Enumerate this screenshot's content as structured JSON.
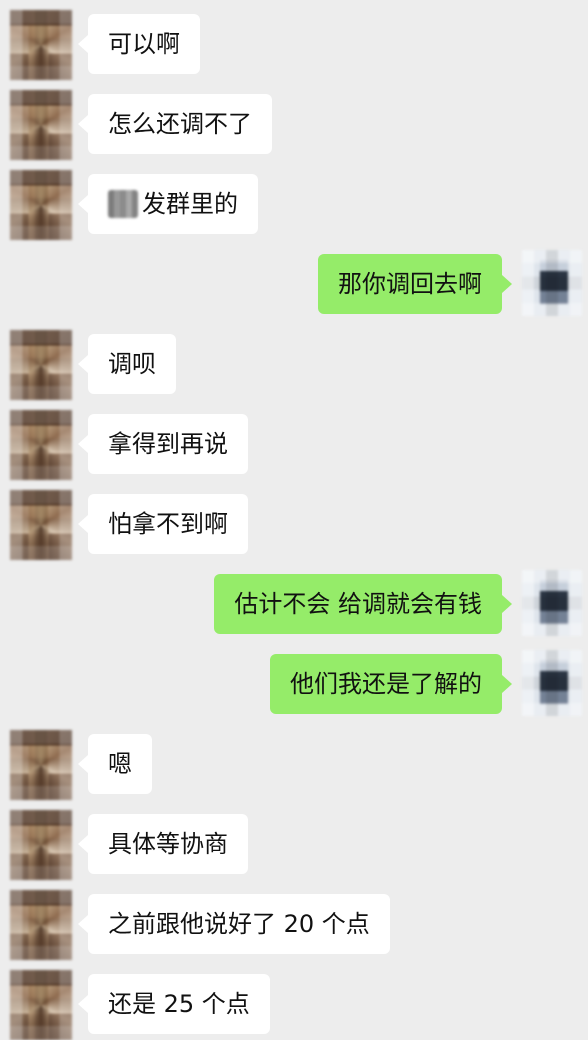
{
  "chat": {
    "messages": [
      {
        "side": "left",
        "text": "可以啊"
      },
      {
        "side": "left",
        "text": "怎么还调不了"
      },
      {
        "side": "left",
        "text": "发群里的",
        "redacted_prefix": true
      },
      {
        "side": "right",
        "text": "那你调回去啊"
      },
      {
        "side": "left",
        "text": "调呗"
      },
      {
        "side": "left",
        "text": "拿得到再说"
      },
      {
        "side": "left",
        "text": "怕拿不到啊"
      },
      {
        "side": "right",
        "text": "估计不会 给调就会有钱"
      },
      {
        "side": "right",
        "text": "他们我还是了解的"
      },
      {
        "side": "left",
        "text": "嗯"
      },
      {
        "side": "left",
        "text": "具体等协商"
      },
      {
        "side": "left",
        "text": "之前跟他说好了 20 个点"
      },
      {
        "side": "left",
        "text": "还是 25 个点"
      }
    ]
  },
  "colors": {
    "background": "#ededed",
    "incoming_bubble": "#ffffff",
    "outgoing_bubble": "#95ec69",
    "text": "#111111"
  }
}
